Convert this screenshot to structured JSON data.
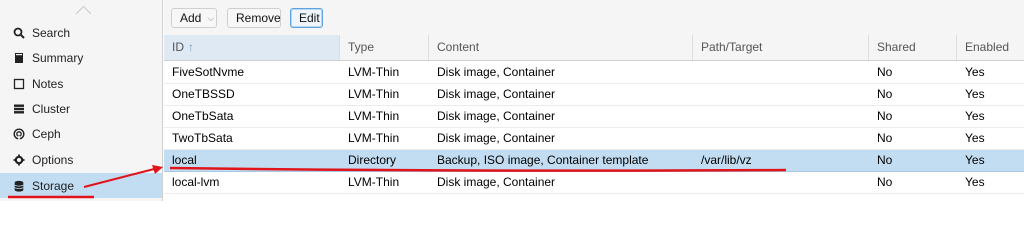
{
  "sidebar": {
    "items": [
      {
        "label": "Search",
        "icon": "search-icon"
      },
      {
        "label": "Summary",
        "icon": "book-icon"
      },
      {
        "label": "Notes",
        "icon": "note-icon"
      },
      {
        "label": "Cluster",
        "icon": "server-icon"
      },
      {
        "label": "Ceph",
        "icon": "ceph-icon"
      },
      {
        "label": "Options",
        "icon": "gear-icon"
      },
      {
        "label": "Storage",
        "icon": "database-icon",
        "selected": true
      }
    ]
  },
  "toolbar": {
    "add_label": "Add",
    "remove_label": "Remove",
    "edit_label": "Edit"
  },
  "grid": {
    "columns": [
      "ID",
      "Type",
      "Content",
      "Path/Target",
      "Shared",
      "Enabled"
    ],
    "sort_indicator": "↑",
    "rows": [
      {
        "id": "FiveSotNvme",
        "type": "LVM-Thin",
        "content": "Disk image, Container",
        "path": "",
        "shared": "No",
        "enabled": "Yes"
      },
      {
        "id": "OneTBSSD",
        "type": "LVM-Thin",
        "content": "Disk image, Container",
        "path": "",
        "shared": "No",
        "enabled": "Yes"
      },
      {
        "id": "OneTbSata",
        "type": "LVM-Thin",
        "content": "Disk image, Container",
        "path": "",
        "shared": "No",
        "enabled": "Yes"
      },
      {
        "id": "TwoTbSata",
        "type": "LVM-Thin",
        "content": "Disk image, Container",
        "path": "",
        "shared": "No",
        "enabled": "Yes"
      },
      {
        "id": "local",
        "type": "Directory",
        "content": "Backup, ISO image, Container template",
        "path": "/var/lib/vz",
        "shared": "No",
        "enabled": "Yes",
        "selected": true
      },
      {
        "id": "local-lvm",
        "type": "LVM-Thin",
        "content": "Disk image, Container",
        "path": "",
        "shared": "No",
        "enabled": "Yes"
      }
    ]
  },
  "colors": {
    "selection": "#c2ddf2",
    "annotation": "#e0151b"
  }
}
